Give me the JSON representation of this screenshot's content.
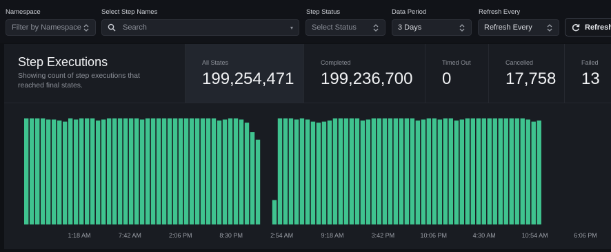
{
  "filters": {
    "namespace": {
      "label": "Namespace",
      "value": "Filter by Namespace"
    },
    "step_names": {
      "label": "Select Step Names",
      "placeholder": "Search"
    },
    "step_status": {
      "label": "Step Status",
      "value": "Select Status"
    },
    "data_period": {
      "label": "Data Period",
      "value": "3 Days"
    },
    "refresh_every": {
      "label": "Refresh Every",
      "value": "Refresh Every"
    },
    "refresh_button": "Refresh"
  },
  "panel": {
    "title": "Step Executions",
    "subtitle": "Showing count of step executions that reached final states.",
    "stats": [
      {
        "label": "All States",
        "value": "199,254,471"
      },
      {
        "label": "Completed",
        "value": "199,236,700"
      },
      {
        "label": "Timed Out",
        "value": "0"
      },
      {
        "label": "Cancelled",
        "value": "17,758"
      },
      {
        "label": "Failed",
        "value": "13"
      }
    ]
  },
  "colors": {
    "bar": "#3fc38f",
    "accent_bg": "#22262e"
  },
  "chart_data": {
    "type": "bar",
    "title": "",
    "xlabel": "",
    "ylabel": "",
    "x_tick_labels": [
      "1:18 AM",
      "7:42 AM",
      "2:06 PM",
      "8:30 PM",
      "2:54 AM",
      "9:18 AM",
      "3:42 PM",
      "10:06 PM",
      "4:30 AM",
      "10:54 AM",
      "6:06 PM"
    ],
    "ylim": [
      0,
      100
    ],
    "grid": false,
    "series": [
      {
        "values": [
          100,
          100,
          100,
          100,
          99,
          99,
          98,
          97,
          100,
          99,
          100,
          100,
          100,
          98,
          99,
          100,
          100,
          100,
          100,
          100,
          100,
          99,
          100,
          100,
          100,
          100,
          100,
          100,
          100,
          100,
          100,
          100,
          100,
          100,
          100,
          98,
          99,
          100,
          100,
          99,
          96,
          87,
          80,
          0,
          0,
          23,
          100,
          100,
          100,
          99,
          100,
          99,
          97,
          96,
          97,
          98,
          100,
          100,
          100,
          100,
          100,
          98,
          99,
          100,
          100,
          100,
          100,
          100,
          100,
          100,
          100,
          98,
          99,
          100,
          100,
          99,
          100,
          100,
          98,
          99,
          100,
          100,
          100,
          100,
          100,
          100,
          100,
          100,
          100,
          100,
          100,
          99,
          97,
          98
        ]
      }
    ]
  }
}
